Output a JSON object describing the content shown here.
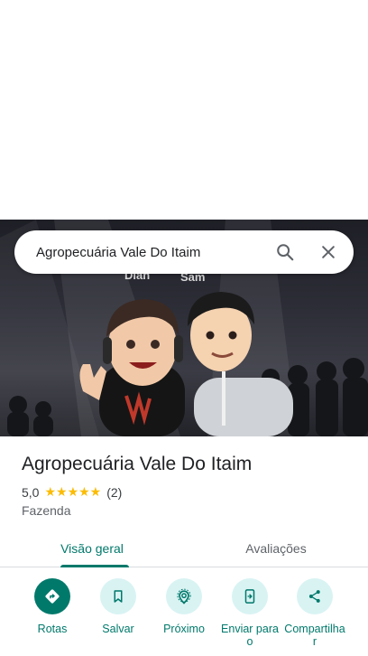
{
  "search": {
    "query": "Agropecuária Vale Do Itaim"
  },
  "hero": {
    "sign_left": "Dian",
    "sign_right": "Sam"
  },
  "place": {
    "title": "Agropecuária Vale Do Itaim",
    "rating": "5,0",
    "stars": "★★★★★",
    "review_count": "(2)",
    "category": "Fazenda"
  },
  "tabs": [
    {
      "label": "Visão geral",
      "active": true
    },
    {
      "label": "Avaliações",
      "active": false
    }
  ],
  "actions": [
    {
      "label": "Rotas",
      "icon": "directions-icon"
    },
    {
      "label": "Salvar",
      "icon": "bookmark-icon"
    },
    {
      "label": "Próximo",
      "icon": "nearby-icon"
    },
    {
      "label": "Enviar para o",
      "icon": "send-to-phone-icon"
    },
    {
      "label": "Compartilha r",
      "icon": "share-icon"
    }
  ],
  "colors": {
    "accent": "#00796b",
    "action_bg": "#d9f3f3",
    "star": "#fbbc04"
  }
}
